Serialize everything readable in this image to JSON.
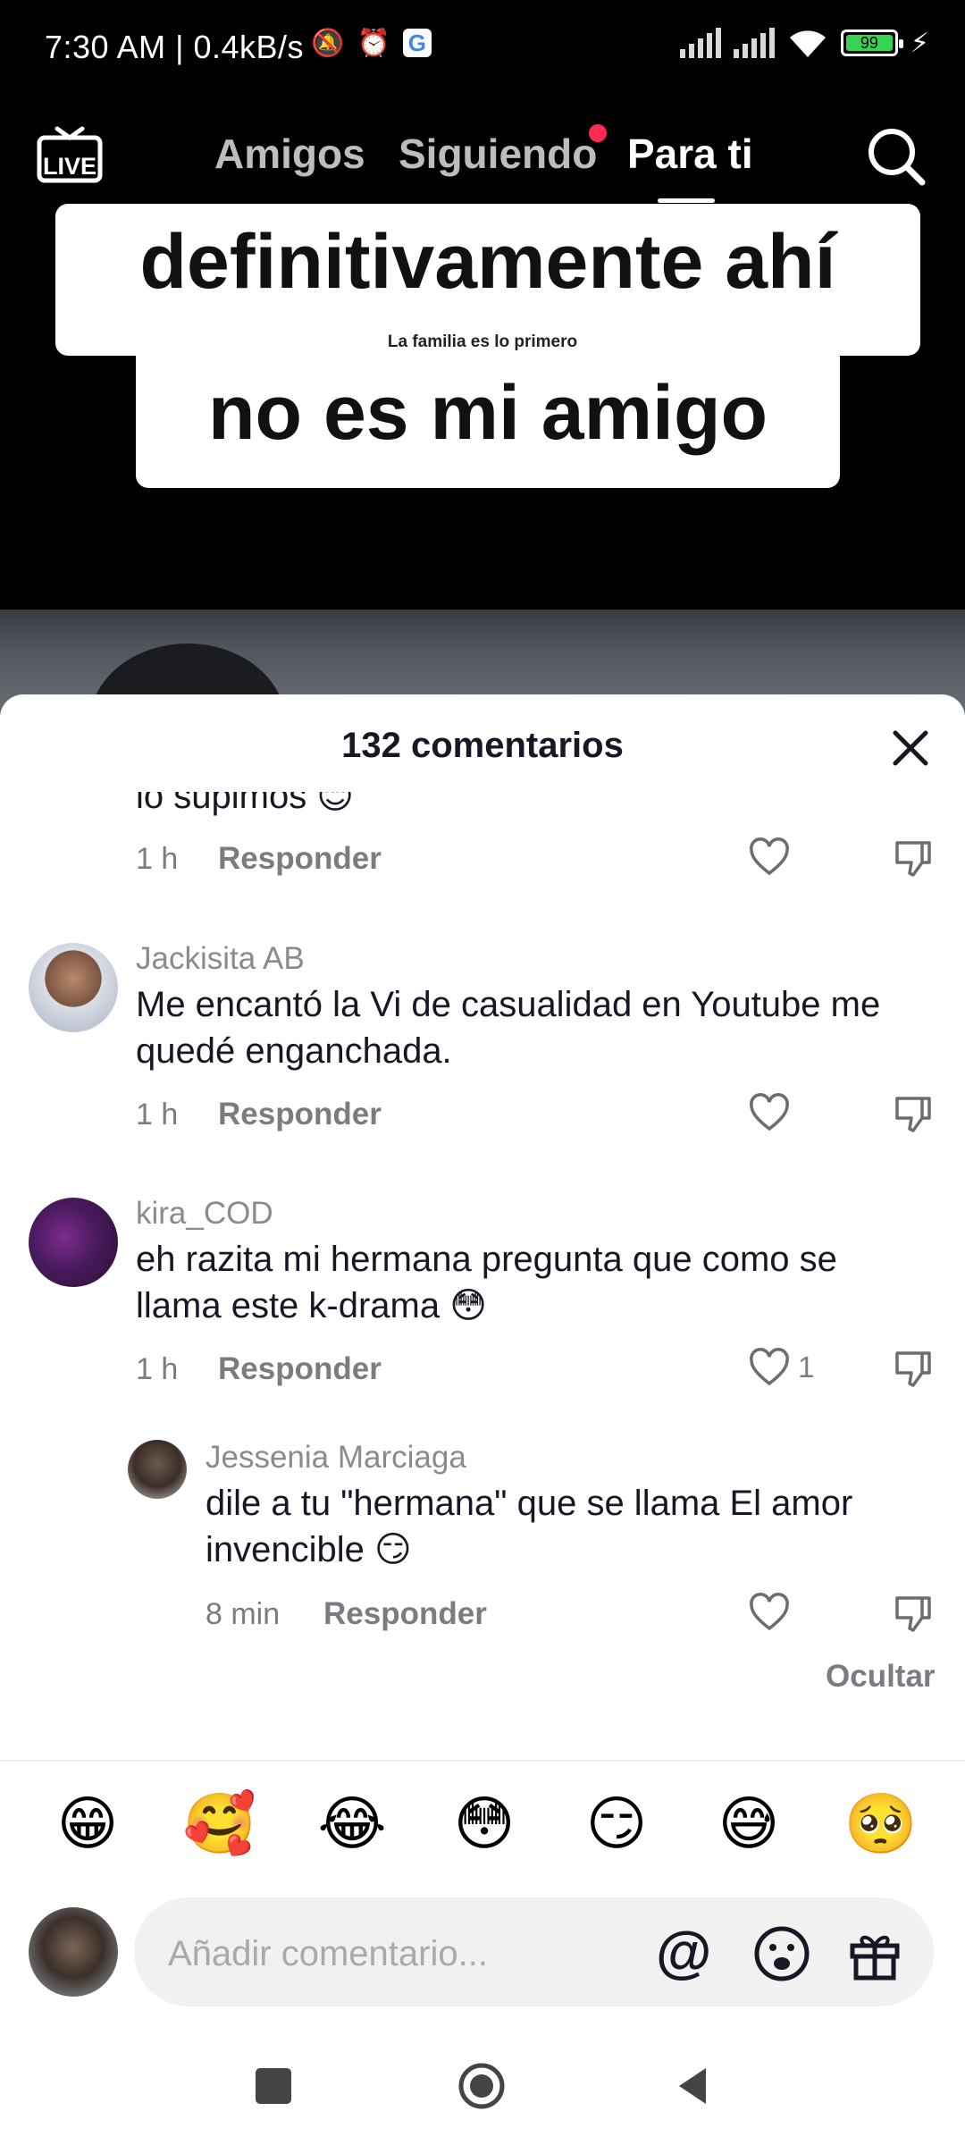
{
  "status_bar": {
    "time": "7:30 AM | 0.4kB/s",
    "battery_level": "99"
  },
  "top_nav": {
    "live_label": "LIVE",
    "tabs": [
      {
        "label": "Amigos"
      },
      {
        "label": "Siguiendo"
      },
      {
        "label": "Para ti"
      }
    ],
    "active_tab": "Para ti",
    "accent": "#fe2c55"
  },
  "video": {
    "caption_line1": "definitivamente ahí",
    "caption_small": "La familia es lo primero",
    "caption_line2": "no es mi amigo"
  },
  "comments_sheet": {
    "title": "132 comentarios",
    "clipped_text": "lo supimos 😊",
    "clipped_time": "1 h",
    "reply_label": "Responder",
    "comments": [
      {
        "user": "Jackisita AB",
        "text": "Me encantó la Vi de casualidad en Youtube me quedé enganchada.",
        "time": "1 h"
      },
      {
        "user": "kira_COD",
        "text": "eh razita mi hermana pregunta que como se llama este k-drama 😳",
        "time": "1 h",
        "likes": "1"
      }
    ],
    "replies": [
      {
        "user": "Jessenia Marciaga",
        "text": "dile a tu \"hermana\" que se llama El amor invencible 😏",
        "time": "8 min"
      }
    ],
    "hide_label": "Ocultar"
  },
  "emoji_row": [
    "😁",
    "🥰",
    "😂",
    "😳",
    "😏",
    "😅",
    "🥺"
  ],
  "input": {
    "placeholder": "Añadir comentario...",
    "mention_symbol": "@"
  }
}
